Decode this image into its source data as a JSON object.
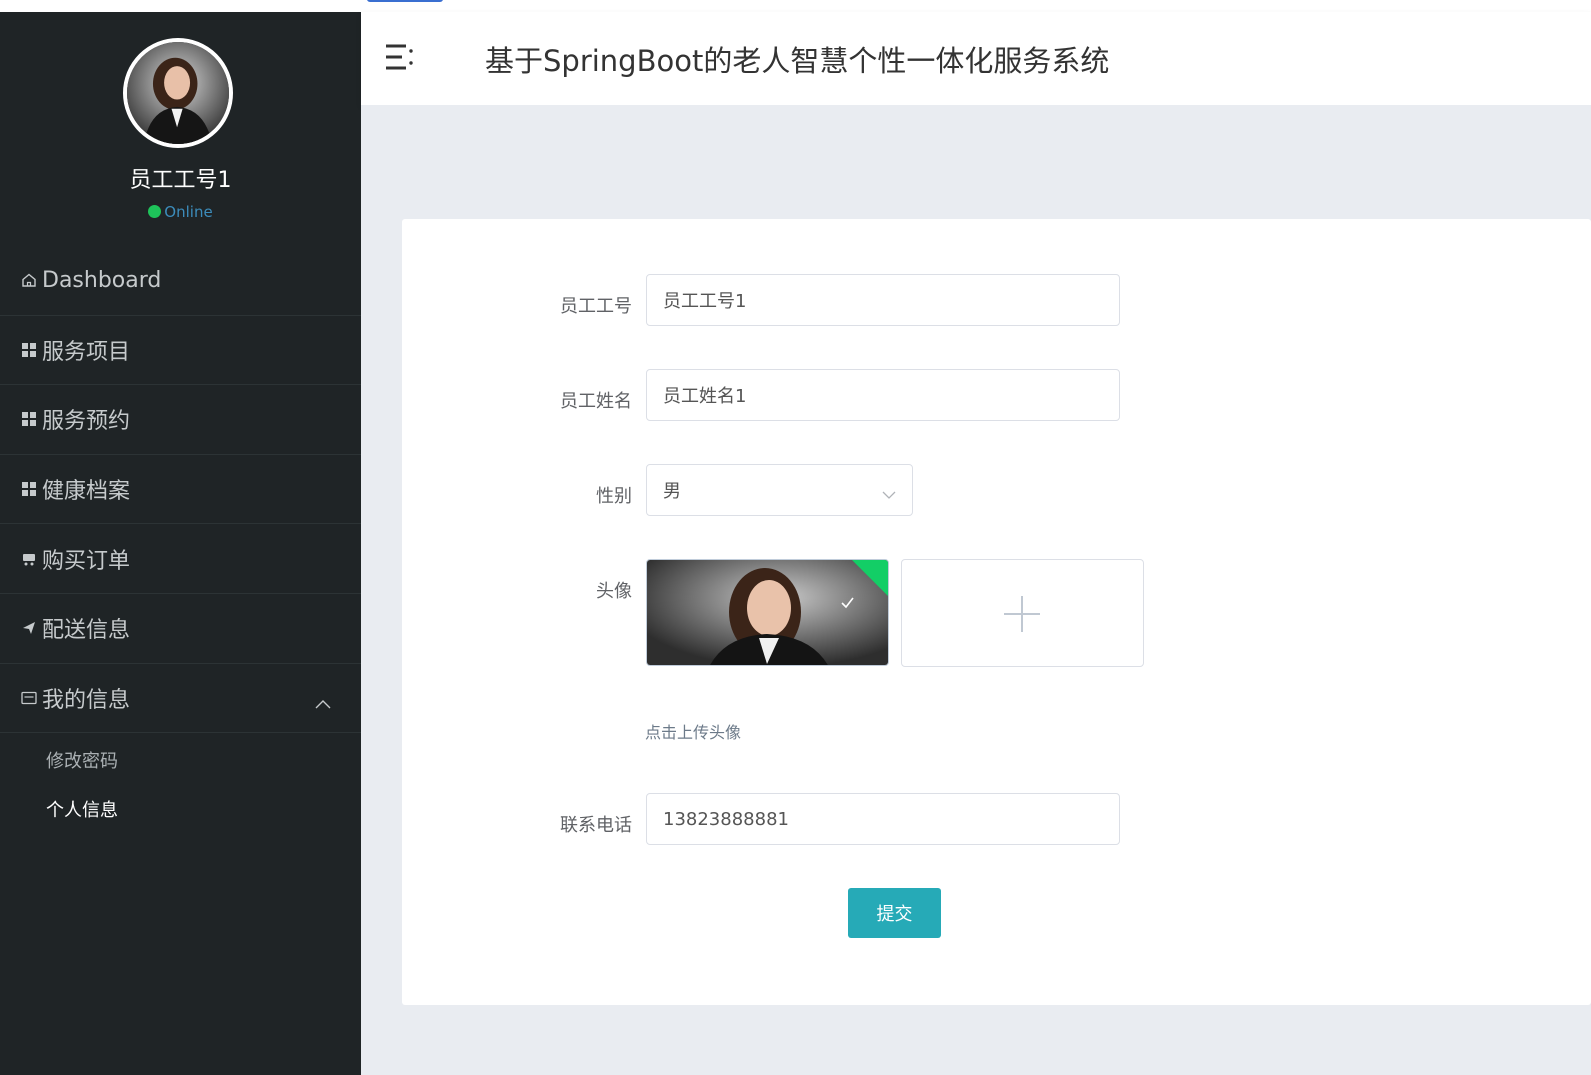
{
  "header": {
    "title": "基于SpringBoot的老人智慧个性一体化服务系统"
  },
  "user": {
    "name": "员工工号1",
    "status": "Online"
  },
  "menu": {
    "items": [
      {
        "label": "Dashboard",
        "icon": "home-icon"
      },
      {
        "label": "服务项目",
        "icon": "grid-icon"
      },
      {
        "label": "服务预约",
        "icon": "grid-icon"
      },
      {
        "label": "健康档案",
        "icon": "grid-icon"
      },
      {
        "label": "购买订单",
        "icon": "cart-icon"
      },
      {
        "label": "配送信息",
        "icon": "send-icon"
      },
      {
        "label": "我的信息",
        "icon": "card-icon",
        "expanded": true
      }
    ],
    "submenu": [
      {
        "label": "修改密码"
      },
      {
        "label": "个人信息",
        "active": true
      }
    ]
  },
  "form": {
    "employee_id": {
      "label": "员工工号",
      "value": "员工工号1"
    },
    "employee_name": {
      "label": "员工姓名",
      "value": "员工姓名1"
    },
    "gender": {
      "label": "性别",
      "value": "男"
    },
    "avatar": {
      "label": "头像",
      "hint": "点击上传头像"
    },
    "phone": {
      "label": "联系电话",
      "value": "13823888881"
    },
    "submit_label": "提交"
  },
  "colors": {
    "sidebar_bg": "#1f2426",
    "accent": "#26aab7",
    "online": "#1ec35a",
    "success_badge": "#13ce66"
  }
}
